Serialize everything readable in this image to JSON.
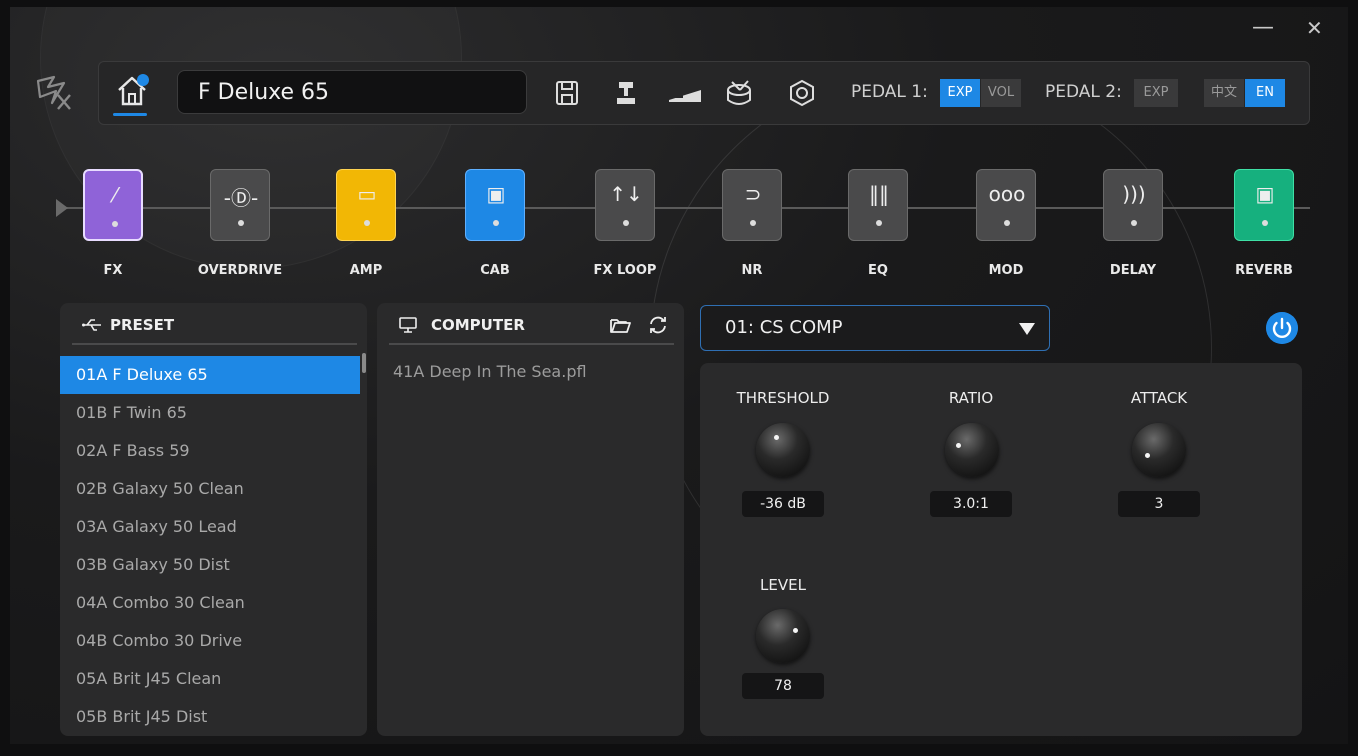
{
  "window": {
    "minimize": "—",
    "close": "✕"
  },
  "header": {
    "preset_name": "F Deluxe 65",
    "pedal1_label": "PEDAL 1:",
    "pedal1_options": [
      "EXP",
      "VOL"
    ],
    "pedal2_label": "PEDAL 2:",
    "pedal2_options": [
      "EXP"
    ],
    "languages": [
      "中文",
      "EN"
    ],
    "selected_language": "EN",
    "pedal1_selected": "EXP"
  },
  "chain": [
    {
      "label": "FX",
      "icon": "fx-icon",
      "color": "#8f63d8",
      "active": true
    },
    {
      "label": "OVERDRIVE",
      "icon": "overdrive-icon",
      "color": "#4a4a4b",
      "active": false
    },
    {
      "label": "AMP",
      "icon": "amp-icon",
      "color": "#f2b705",
      "active": true
    },
    {
      "label": "CAB",
      "icon": "cab-icon",
      "color": "#1e88e5",
      "active": true
    },
    {
      "label": "FX LOOP",
      "icon": "fx-loop-icon",
      "color": "#4a4a4b",
      "active": false
    },
    {
      "label": "NR",
      "icon": "nr-icon",
      "color": "#4a4a4b",
      "active": false
    },
    {
      "label": "EQ",
      "icon": "eq-icon",
      "color": "#4a4a4b",
      "active": false
    },
    {
      "label": "MOD",
      "icon": "mod-icon",
      "color": "#4a4a4b",
      "active": false
    },
    {
      "label": "DELAY",
      "icon": "delay-icon",
      "color": "#4a4a4b",
      "active": false
    },
    {
      "label": "REVERB",
      "icon": "reverb-icon",
      "color": "#16b07e",
      "active": true
    }
  ],
  "preset_panel": {
    "title": "PRESET",
    "items": [
      "01A F Deluxe 65",
      "01B F Twin 65",
      "02A F Bass 59",
      "02B Galaxy 50 Clean",
      "03A Galaxy 50 Lead",
      "03B Galaxy 50 Dist",
      "04A Combo 30 Clean",
      "04B Combo 30 Drive",
      "05A Brit J45 Clean",
      "05B Brit J45 Dist"
    ],
    "selected_index": 0
  },
  "computer_panel": {
    "title": "COMPUTER",
    "items": [
      "41A Deep In The Sea.pfl"
    ]
  },
  "effect": {
    "model": "01: CS COMP",
    "power_on": true,
    "knobs": [
      {
        "name": "THRESHOLD",
        "value": "-36 dB"
      },
      {
        "name": "RATIO",
        "value": "3.0:1"
      },
      {
        "name": "ATTACK",
        "value": "3"
      },
      {
        "name": "LEVEL",
        "value": "78"
      }
    ]
  },
  "colors": {
    "accent": "#1e88e5",
    "fx": "#8f63d8",
    "amp": "#f2b705",
    "reverb": "#16b07e"
  }
}
